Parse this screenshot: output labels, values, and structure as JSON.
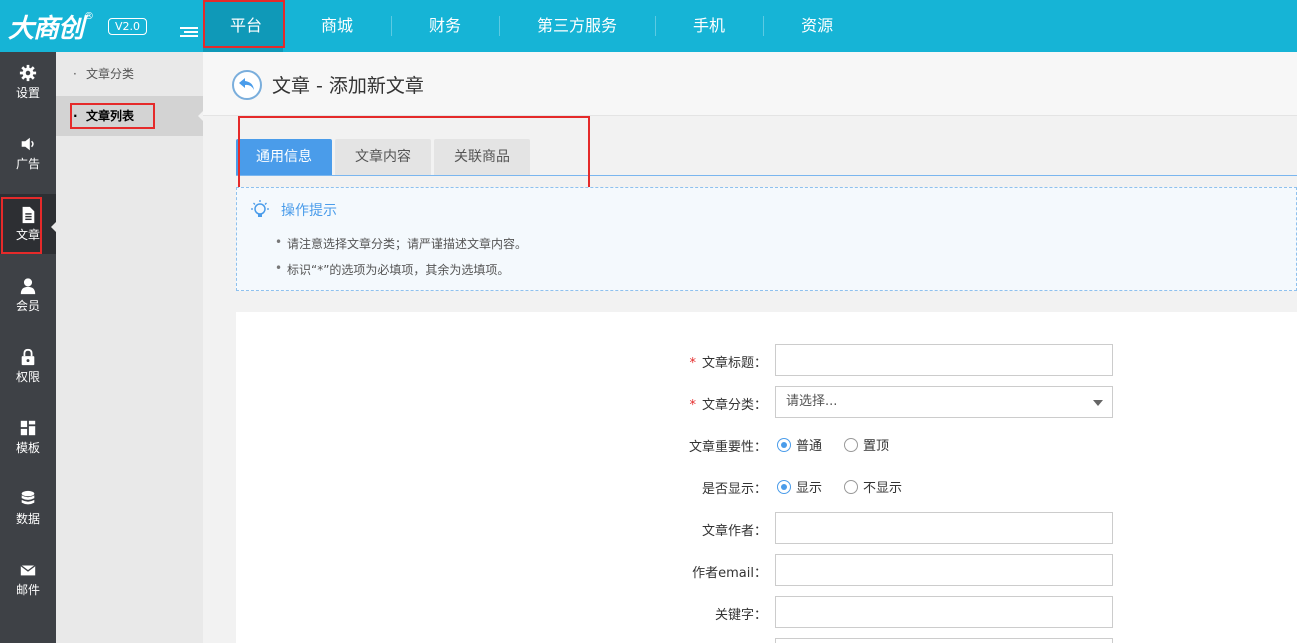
{
  "brand": {
    "logo_text": "大商创",
    "reg_mark": "®",
    "version": "V2.0"
  },
  "top_nav": [
    {
      "label": "平台",
      "active": true
    },
    {
      "label": "商城"
    },
    {
      "label": "财务"
    },
    {
      "label": "第三方服务"
    },
    {
      "label": "手机"
    },
    {
      "label": "资源"
    }
  ],
  "sidebar": [
    {
      "label": "设置",
      "icon": "gear-icon"
    },
    {
      "label": "广告",
      "icon": "speaker-icon"
    },
    {
      "label": "文章",
      "icon": "document-icon",
      "active": true
    },
    {
      "label": "会员",
      "icon": "user-icon"
    },
    {
      "label": "权限",
      "icon": "lock-icon"
    },
    {
      "label": "模板",
      "icon": "layout-icon"
    },
    {
      "label": "数据",
      "icon": "database-icon"
    },
    {
      "label": "邮件",
      "icon": "mail-icon"
    }
  ],
  "subnav": [
    {
      "label": "文章分类"
    },
    {
      "label": "文章列表",
      "active": true
    }
  ],
  "page": {
    "title": "文章 - 添加新文章"
  },
  "tabs": [
    {
      "label": "通用信息",
      "active": true
    },
    {
      "label": "文章内容"
    },
    {
      "label": "关联商品"
    }
  ],
  "tips": {
    "title": "操作提示",
    "lines": [
      "请注意选择文章分类；请严谨描述文章内容。",
      "标识“*”的选项为必填项，其余为选填项。"
    ]
  },
  "form": {
    "title_label": "文章标题：",
    "title_value": "",
    "category_label": "文章分类：",
    "category_value": "请选择...",
    "importance_label": "文章重要性：",
    "importance_options": [
      "普通",
      "置顶"
    ],
    "importance_selected": "普通",
    "display_label": "是否显示：",
    "display_options": [
      "显示",
      "不显示"
    ],
    "display_selected": "显示",
    "author_label": "文章作者：",
    "author_value": "",
    "email_label": "作者email：",
    "email_value": "",
    "keywords_label": "关键字：",
    "keywords_value": ""
  },
  "colors": {
    "topbar": "#16b4d6",
    "sidebar": "#3e4146",
    "accent": "#4a9cea",
    "highlight": "#e52a2a"
  }
}
